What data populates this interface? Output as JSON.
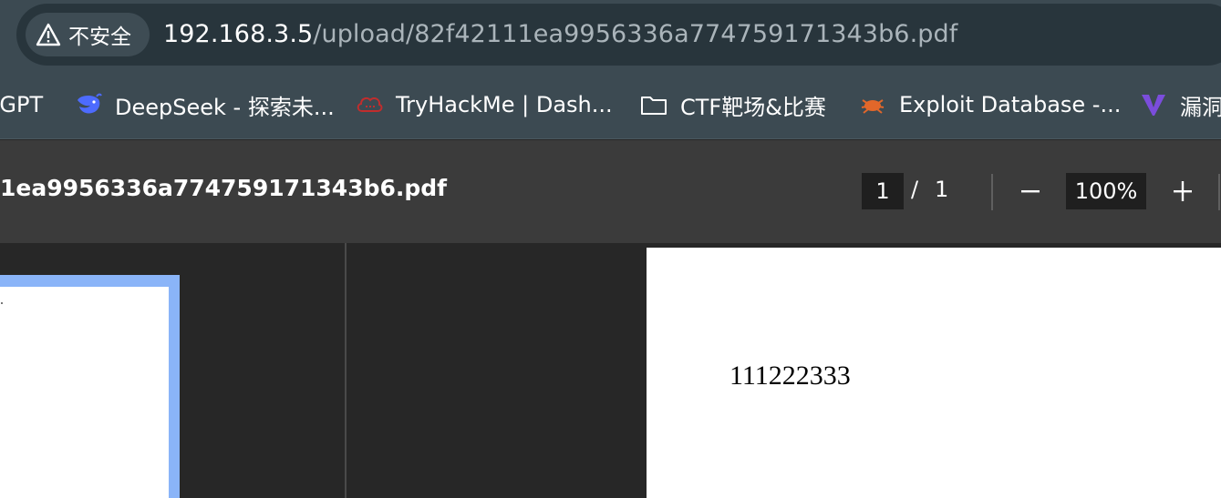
{
  "browser": {
    "security_label": "不安全",
    "url_host": "192.168.3.5",
    "url_path": "/upload/82f42111ea9956336a774759171343b6.pdf"
  },
  "bookmarks": [
    {
      "label": "tGPT",
      "icon": "chatgpt-icon"
    },
    {
      "label": "DeepSeek - 探索未...",
      "icon": "deepseek-whale-icon"
    },
    {
      "label": "TryHackMe | Dash...",
      "icon": "tryhackme-cloud-icon"
    },
    {
      "label": "CTF靶场&比赛",
      "icon": "folder-icon"
    },
    {
      "label": "Exploit Database -...",
      "icon": "exploit-db-bug-icon"
    },
    {
      "label": "漏洞",
      "icon": "vulnerability-v-icon"
    }
  ],
  "pdf_viewer": {
    "title": "1ea9956336a774759171343b6.pdf",
    "current_page": "1",
    "page_separator": "/",
    "total_pages": "1",
    "zoom": "100%",
    "page_text": "111222333"
  },
  "colors": {
    "toolbar_bg": "#3c4a52",
    "omnibox_bg": "#28353c",
    "pdf_toolbar_bg": "#3b3b3b",
    "viewer_bg": "#272727",
    "thumbnail_highlight": "#8ab4f8"
  }
}
